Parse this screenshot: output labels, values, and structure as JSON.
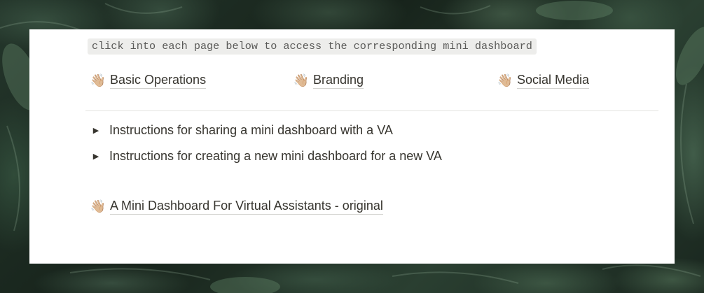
{
  "header": {
    "instruction_code": "click into each page below to access the corresponding mini dashboard"
  },
  "pages": [
    {
      "icon": "waving-hand-icon",
      "emoji": "👋🏼",
      "label": "Basic Operations"
    },
    {
      "icon": "waving-hand-icon",
      "emoji": "👋🏼",
      "label": "Branding"
    },
    {
      "icon": "waving-hand-icon",
      "emoji": "👋🏼",
      "label": "Social Media"
    }
  ],
  "toggles": [
    {
      "icon": "triangle-right-icon",
      "glyph": "▶",
      "label": "Instructions for sharing a mini dashboard with a VA"
    },
    {
      "icon": "triangle-right-icon",
      "glyph": "▶",
      "label": "Instructions for creating a new mini dashboard for a new VA"
    }
  ],
  "legacy_page": {
    "icon": "waving-hand-icon",
    "emoji": "👋🏼",
    "label": "A Mini Dashboard For Virtual Assistants - original"
  },
  "colors": {
    "text": "#37352f",
    "code_bg": "#ededeb",
    "code_text": "#5a5a58",
    "card_bg": "#ffffff",
    "background": "#1e2c23"
  }
}
